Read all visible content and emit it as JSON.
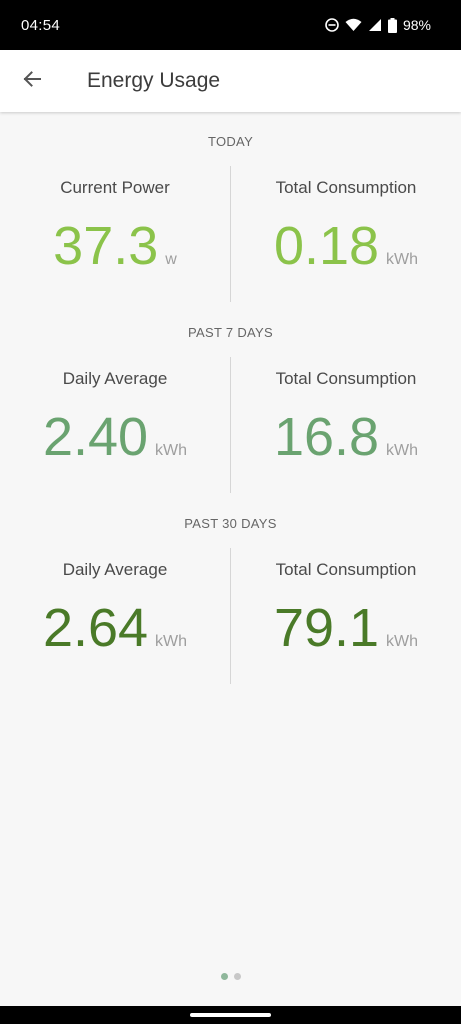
{
  "status_bar": {
    "time": "04:54",
    "battery": "98%",
    "icons": [
      "dnd-icon",
      "wifi-icon",
      "signal-icon",
      "battery-icon"
    ]
  },
  "app_bar": {
    "title": "Energy Usage",
    "back_icon": "arrow-back-icon"
  },
  "sections": [
    {
      "label": "TODAY",
      "left": {
        "title": "Current Power",
        "value": "37.3",
        "unit": "w",
        "color": "#8bc34a"
      },
      "right": {
        "title": "Total Consumption",
        "value": "0.18",
        "unit": "kWh",
        "color": "#8bc34a"
      }
    },
    {
      "label": "PAST 7 DAYS",
      "left": {
        "title": "Daily Average",
        "value": "2.40",
        "unit": "kWh",
        "color": "#6aa370"
      },
      "right": {
        "title": "Total Consumption",
        "value": "16.8",
        "unit": "kWh",
        "color": "#6aa370"
      }
    },
    {
      "label": "PAST 30 DAYS",
      "left": {
        "title": "Daily Average",
        "value": "2.64",
        "unit": "kWh",
        "color": "#4a7a28"
      },
      "right": {
        "title": "Total Consumption",
        "value": "79.1",
        "unit": "kWh",
        "color": "#4a7a28"
      }
    }
  ],
  "pager": {
    "page_count": 2,
    "active_index": 0,
    "active_color": "#8fb79b",
    "inactive_color": "#c8c8c8"
  }
}
